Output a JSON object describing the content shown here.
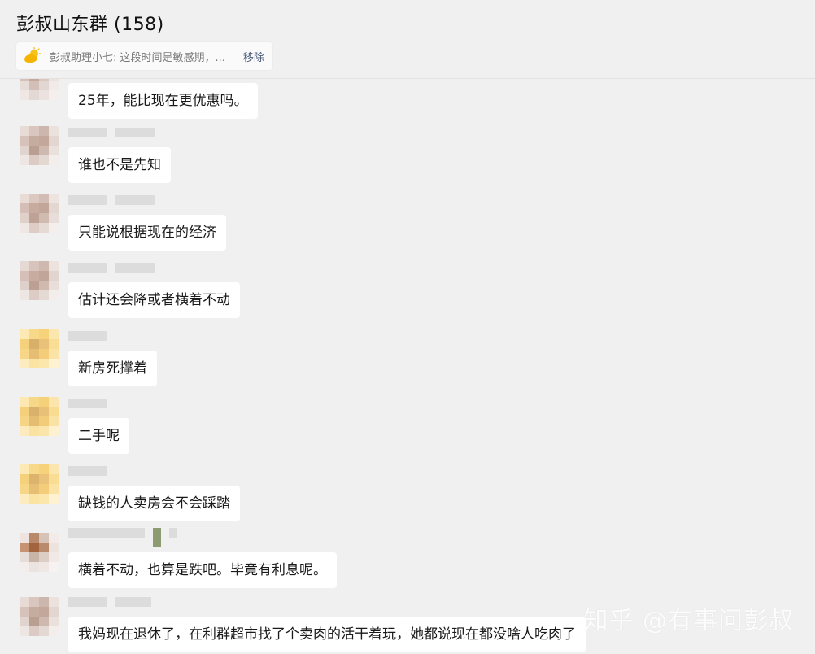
{
  "header": {
    "title": "彭叔山东群 (158)",
    "pinned": {
      "icon": "sun-cloud-icon",
      "text": "彭叔助理小七: 这段时间是敏感期，...",
      "remove_label": "移除"
    }
  },
  "messages": [
    {
      "text": "25年，能比现在更优惠吗。",
      "avatar_tone": "pink"
    },
    {
      "text": "谁也不是先知",
      "avatar_tone": "pink"
    },
    {
      "text": "只能说根据现在的经济",
      "avatar_tone": "pink"
    },
    {
      "text": "估计还会降或者横着不动",
      "avatar_tone": "pink"
    },
    {
      "text": "新房死撑着",
      "avatar_tone": "yellow"
    },
    {
      "text": "二手呢",
      "avatar_tone": "yellow"
    },
    {
      "text": "缺钱的人卖房会不会踩踏",
      "avatar_tone": "yellow"
    },
    {
      "text": "横着不动，也算是跌吧。毕竟有利息呢。",
      "avatar_tone": "brown"
    },
    {
      "text": "我妈现在退休了，在利群超市找了个卖肉的活干着玩，她都说现在都没啥人吃肉了",
      "avatar_tone": "pink"
    }
  ],
  "watermark": "知乎 @有事问彭叔"
}
